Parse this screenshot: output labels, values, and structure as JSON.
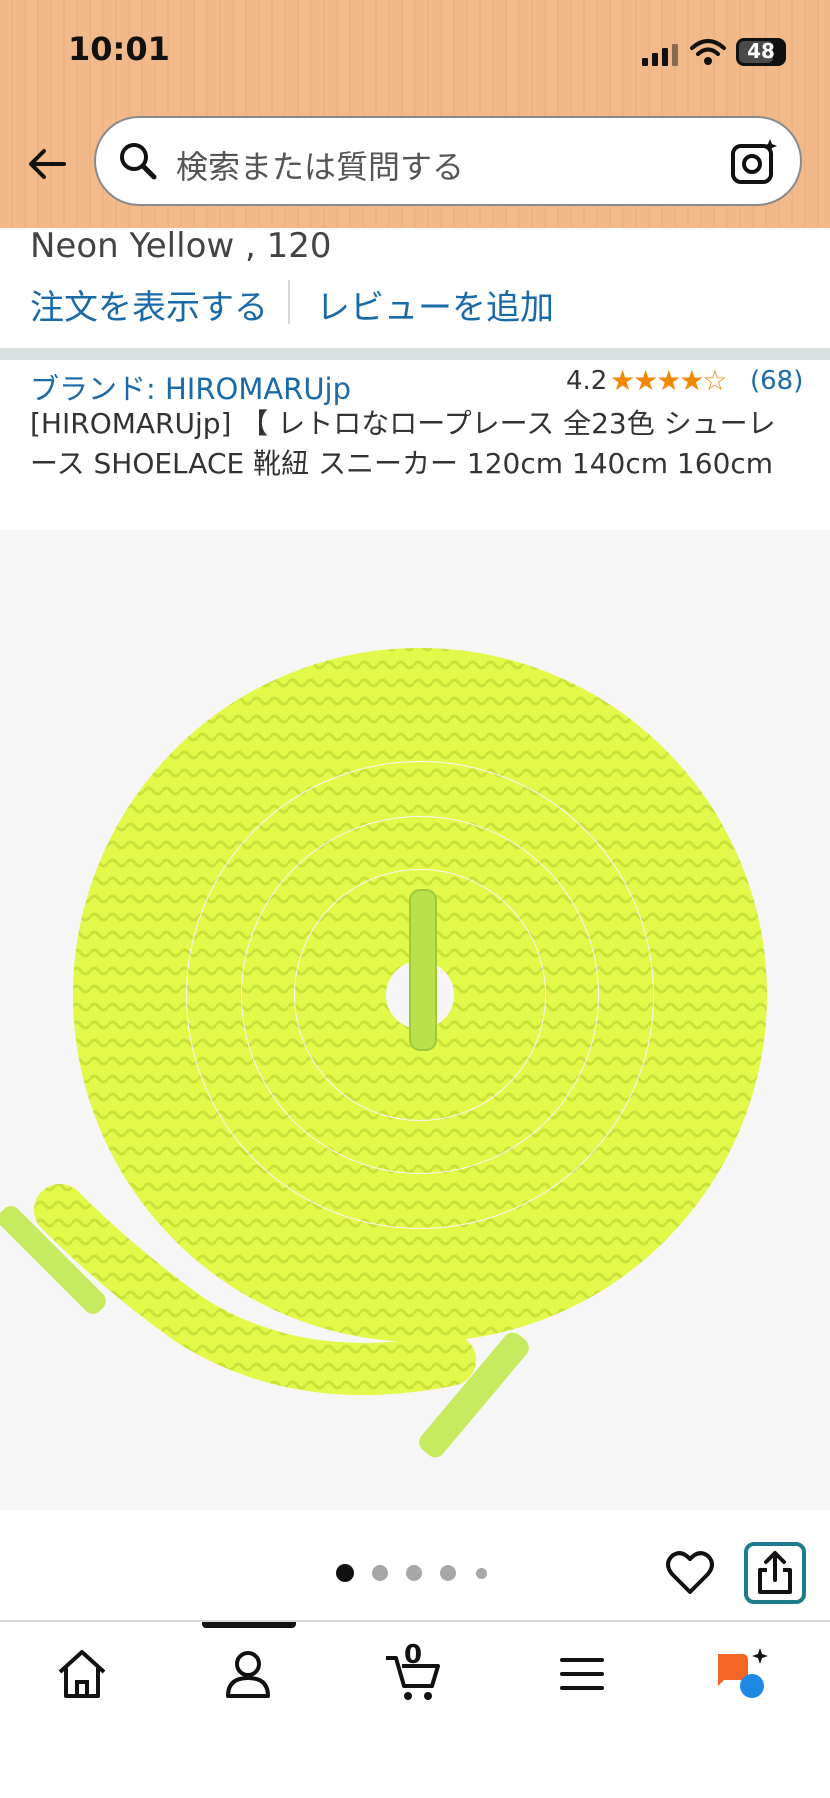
{
  "status_bar": {
    "time": "10:01",
    "battery": "48"
  },
  "search": {
    "placeholder": "検索または質問する"
  },
  "product": {
    "variant": "Neon Yellow , 120",
    "links": {
      "view_order": "注文を表示する",
      "add_review": "レビューを追加"
    },
    "brand": "ブランド: HIROMARUjp",
    "rating": {
      "value": "4.2",
      "stars": "★★★★☆",
      "count": "(68)"
    },
    "title": "[HIROMARUjp] 【 レトロなロープレース 全23色 シューレース SHOELACE 靴紐 スニーカー 120cm 140cm 160cm"
  },
  "image_pager": {
    "count": 5,
    "active": 1
  },
  "bottom_nav": {
    "cart_count": "0",
    "items": [
      "home-icon",
      "account-icon",
      "cart-icon",
      "menu-icon",
      "rufus-ai-icon"
    ]
  },
  "colors": {
    "accent_link": "#1a6aa8",
    "star": "#f08804",
    "header": "#f2b98a",
    "share_border": "#1d7c8c"
  }
}
